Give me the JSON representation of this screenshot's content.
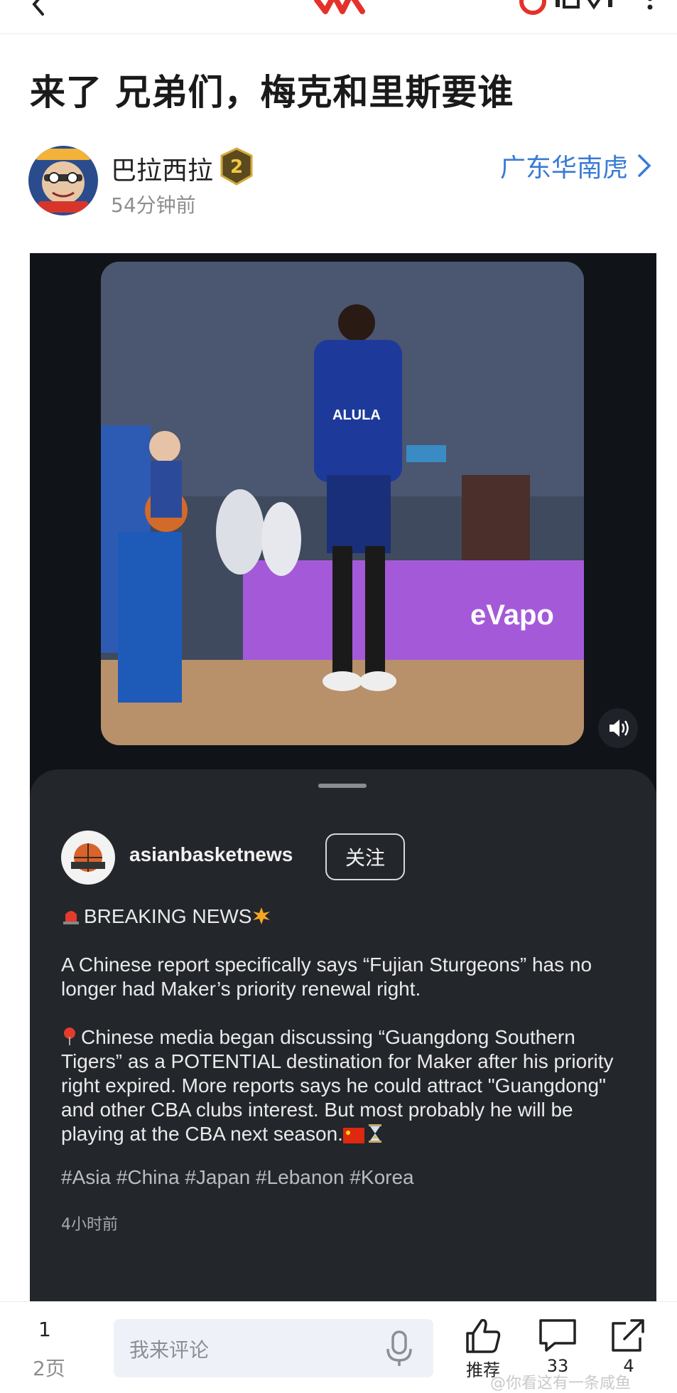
{
  "header": {
    "title": "来了 兄弟们，梅克和里斯要谁"
  },
  "author": {
    "name": "巴拉西拉",
    "level": "2",
    "time_ago": "54分钟前",
    "channel": "广东华南虎"
  },
  "embedded_post": {
    "username": "asianbasketnews",
    "follow_label": "关注",
    "heading": "BREAKING NEWS",
    "paragraph1": "A Chinese report specifically says “Fujian Sturgeons” has no longer had Maker’s priority renewal right.",
    "paragraph2": "Chinese media began discussing “Guangdong Southern Tigers” as a POTENTIAL destination for Maker after his priority right expired. More reports says he could attract \"Guangdong\" and other CBA clubs interest. But most probably he will be playing at the CBA next season.",
    "hashtags": "#Asia #China #Japan #Lebanon #Korea",
    "time": "4小时前",
    "photo_jersey_text": "ALULA",
    "photo_sponsor_text": "eVapo"
  },
  "bottom_bar": {
    "page_current": "1",
    "page_total": "2页",
    "comment_placeholder": "我来评论",
    "like_label": "推荐",
    "comment_count": "33",
    "share_count": "4",
    "watermark": "@你看这有一条咸鱼"
  }
}
